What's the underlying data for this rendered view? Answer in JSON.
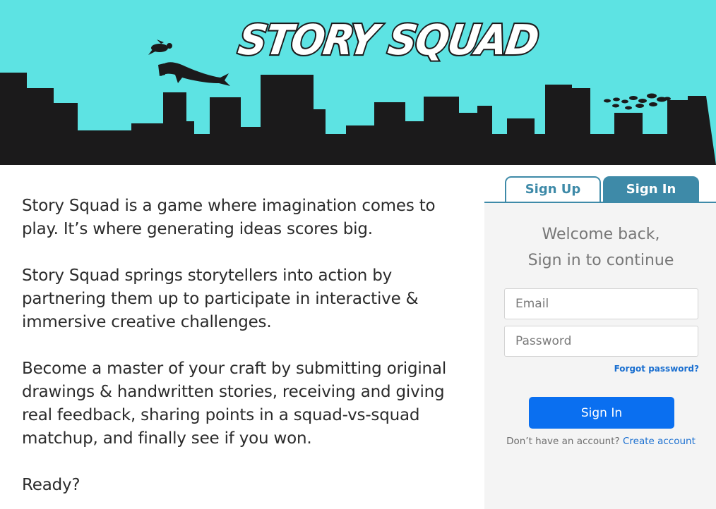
{
  "banner": {
    "logo_text": "STORY SQUAD",
    "sky_color": "#5de3e3",
    "skyline_color": "#1b1a1b"
  },
  "intro": {
    "paragraph_1": "Story Squad is a game where imagination comes to play. It’s where generating ideas scores big.",
    "paragraph_2": "Story Squad springs storytellers into action by partnering them up to participate in interactive & immersive creative challenges.",
    "paragraph_3": "Become a master of your craft by submitting original drawings & handwritten stories, receiving and giving real feedback, sharing points in a squad-vs-squad matchup, and finally see if you won.",
    "paragraph_4": "Ready?"
  },
  "auth": {
    "tabs": [
      {
        "label": "Sign Up",
        "active": false
      },
      {
        "label": "Sign In",
        "active": true
      }
    ],
    "welcome_line_1": "Welcome back,",
    "welcome_line_2": "Sign in to continue",
    "email": {
      "placeholder": "Email",
      "value": ""
    },
    "password": {
      "placeholder": "Password",
      "value": ""
    },
    "forgot_password": "Forgot password?",
    "submit_label": "Sign In",
    "no_account_text": "Don’t have an account?",
    "create_account": "Create account",
    "tab_color": "#3e8aa8",
    "button_color": "#0a6ff0",
    "link_color": "#1a6fd0"
  }
}
